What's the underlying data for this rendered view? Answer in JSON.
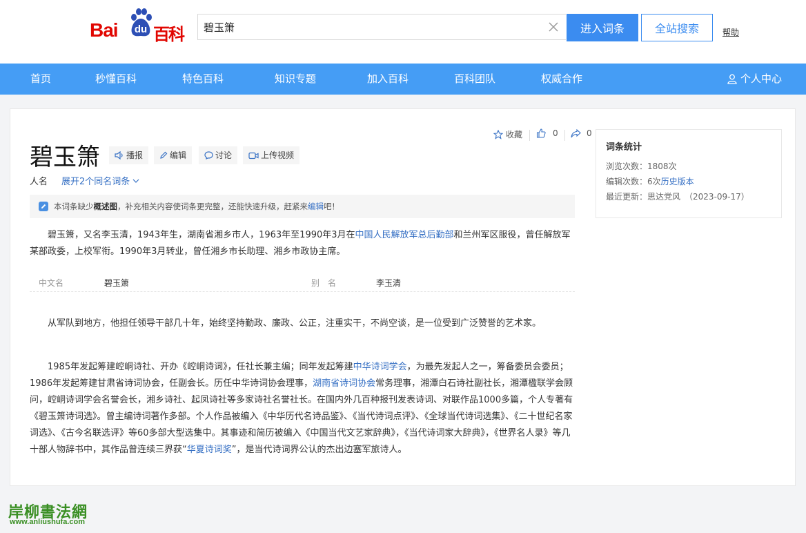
{
  "header": {
    "logo_bai": "Bai",
    "logo_du": "du",
    "logo_baike": "百科",
    "search_value": "碧玉箫",
    "enter_button": "进入词条",
    "site_search_button": "全站搜索",
    "help": "帮助"
  },
  "nav": {
    "items": [
      "首页",
      "秒懂百科",
      "特色百科",
      "知识专题",
      "加入百科",
      "百科团队",
      "权威合作"
    ],
    "user": "个人中心"
  },
  "entry": {
    "title": "碧玉箫",
    "tools": [
      "播报",
      "编辑",
      "讨论",
      "上传视频"
    ],
    "favorite": "收藏",
    "likes": "0",
    "shares": "0",
    "category": "人名",
    "expand": "展开2个同名词条",
    "notice": {
      "p1": "本词条缺少",
      "bold": "概述图",
      "p2": "，补充相关内容使词条更完整，还能快速升级，赶紧来",
      "link": "编辑",
      "p3": "吧！"
    },
    "intro": {
      "p1": "碧玉箫，又名李玉清，1943年生，湖南省湘乡市人，1963年至1990年3月在",
      "link": "中国人民解放军总后勤部",
      "p2": "和兰州军区服役，曾任解放军某部政委，上校军衔。1990年3月转业，曾任湘乡市长助理、湘乡市政协主席。"
    },
    "info": {
      "k1": "中文名",
      "v1": "碧玉箫",
      "k2": "别　名",
      "v2": "李玉清"
    },
    "para2": "从军队到地方，他担任领导干部几十年，始终坚持勤政、廉政、公正，注重实干，不尚空谈，是一位受到广泛赞誉的艺术家。",
    "para3": {
      "p1": "1985年发起筹建崆峒诗社、开办《崆峒诗词》，任社长兼主编；同年发起筹建",
      "link1": "中华诗词学会",
      "p2": "，为最先发起人之一，筹备委员会委员；1986年发起筹建甘肃省诗词协会，任副会长。历任中华诗词协会理事，",
      "link2": "湖南省诗词协会",
      "p3": "常务理事，湘潭白石诗社副社长，湘潭楹联学会顾问，崆峒诗词学会名誉会长，湘乡诗社、起凤诗社等多家诗社名誉社长。在国内外几百种报刊发表诗词、对联作品1000多篇，个人专著有《碧玉箫诗词选》。曾主编诗词著作多部。个人作品被编入《中华历代名诗品鉴》、《当代诗词点评》、《全球当代诗词选集》、《二十世纪名家词选》、《古今名联选评》等60多部大型选集中。其事迹和简历被编入《中国当代文艺家辞典》，《当代诗词家大辞典》，《世界名人录》等几十部人物辞书中，其作品曾连续三界获“",
      "link3": "华夏诗词奖",
      "p4": "”，是当代诗词界公认的杰出边塞军旅诗人。"
    }
  },
  "stats": {
    "title": "词条统计",
    "views_label": "浏览次数：",
    "views": "1808次",
    "edits_label": "编辑次数：",
    "edits": "6次",
    "history_link": "历史版本",
    "updated_label": "最近更新：",
    "updated_by": "思达党风",
    "updated_date": "（2023-09-17）"
  },
  "watermark": {
    "title": "岸柳書法網",
    "url": "www.anliushufa.com"
  },
  "colors": {
    "nav_blue": "#459df5",
    "button_blue": "#3b8cf0",
    "link_blue": "#3670c4",
    "logo_red": "#e10601"
  }
}
